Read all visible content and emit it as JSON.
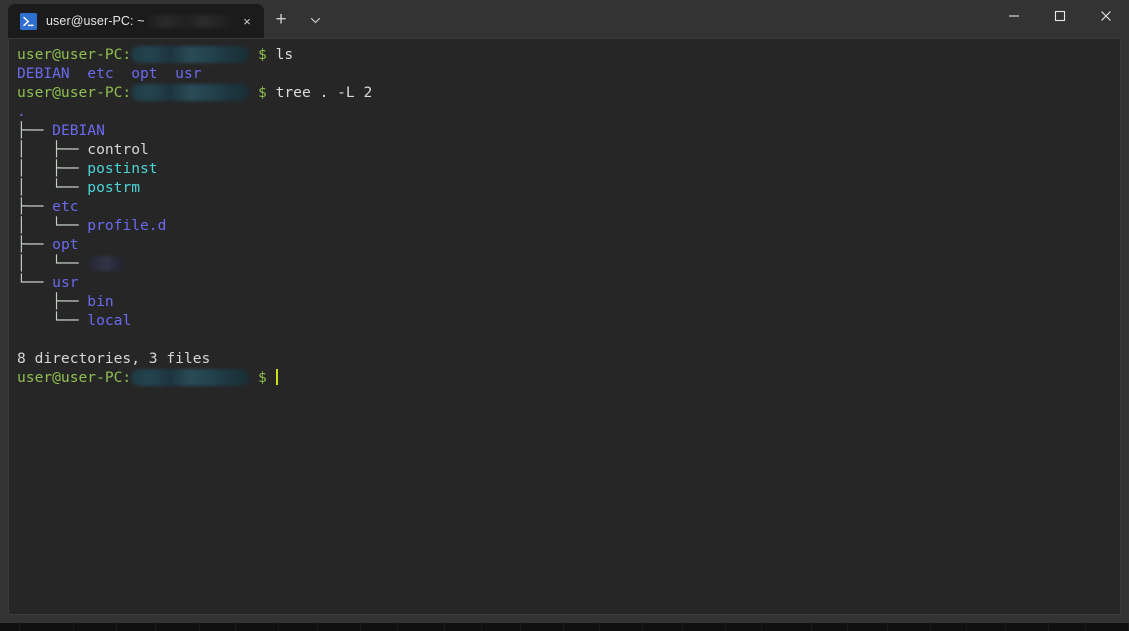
{
  "window": {
    "app": "Windows Terminal",
    "titlebar_color": "#333333",
    "terminal_bg": "#262626"
  },
  "tab": {
    "icon": "powershell-icon",
    "title": "user@user-PC: ~",
    "redacted": true,
    "close_label": "×"
  },
  "tabbar": {
    "new_tab_label": "+",
    "dropdown_label": "∨"
  },
  "window_controls": {
    "minimize": "minimize-icon",
    "maximize": "maximize-icon",
    "close": "close-icon"
  },
  "colors": {
    "prompt_green": "#8fbf50",
    "directory_blue": "#6a6af0",
    "executable_cyan": "#4ad6d6",
    "file_gray": "#d6d6d6",
    "tree_line": "#c3cfc3",
    "cursor": "#c8e014",
    "redaction_path": "#22424e",
    "redaction_name": "#2d2d3d"
  },
  "terminal": {
    "prompt_user_host": "user@user-PC:",
    "prompt_sigil": "$",
    "commands": [
      {
        "text": "ls"
      },
      {
        "text": "tree . -L 2"
      }
    ],
    "ls_output": [
      "DEBIAN",
      "etc",
      "opt",
      "usr"
    ],
    "tree_root": ".",
    "tree_lines": [
      {
        "branch": "├── ",
        "name": "DEBIAN",
        "kind": "dir"
      },
      {
        "branch": "│   ├── ",
        "name": "control",
        "kind": "file"
      },
      {
        "branch": "│   ├── ",
        "name": "postinst",
        "kind": "exec"
      },
      {
        "branch": "│   └── ",
        "name": "postrm",
        "kind": "exec"
      },
      {
        "branch": "├── ",
        "name": "etc",
        "kind": "dir"
      },
      {
        "branch": "│   └── ",
        "name": "profile.d",
        "kind": "dir"
      },
      {
        "branch": "├── ",
        "name": "opt",
        "kind": "dir"
      },
      {
        "branch": "│   └── ",
        "name": "",
        "kind": "redacted"
      },
      {
        "branch": "└── ",
        "name": "usr",
        "kind": "dir"
      },
      {
        "branch": "    ├── ",
        "name": "bin",
        "kind": "dir"
      },
      {
        "branch": "    └── ",
        "name": "local",
        "kind": "dir"
      }
    ],
    "summary": "8 directories, 3 files"
  }
}
